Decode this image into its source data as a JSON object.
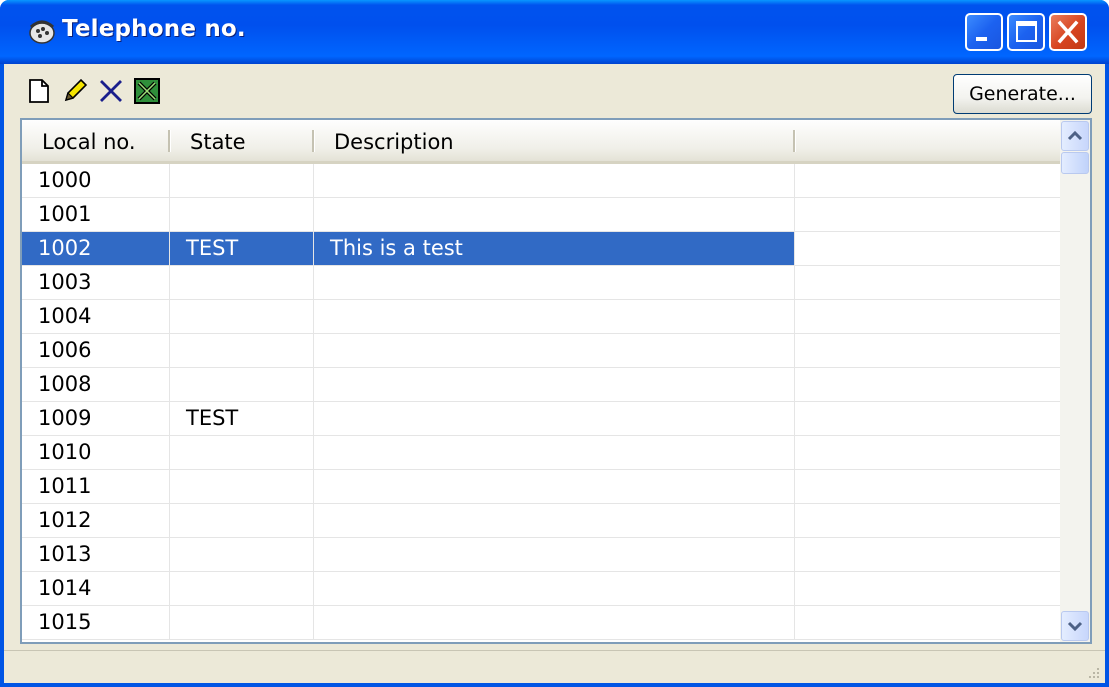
{
  "window": {
    "title": "Telephone no.",
    "icon": "phone-icon"
  },
  "toolbar": {
    "new_icon": "new-document-icon",
    "edit_icon": "pencil-icon",
    "delete_icon": "delete-x-icon",
    "excel_icon": "excel-export-icon",
    "generate_label": "Generate..."
  },
  "table": {
    "columns": [
      "Local no.",
      "State",
      "Description",
      ""
    ],
    "rows": [
      {
        "local": "1000",
        "state": "",
        "description": ""
      },
      {
        "local": "1001",
        "state": "",
        "description": ""
      },
      {
        "local": "1002",
        "state": "TEST",
        "description": "This is a test",
        "selected": true
      },
      {
        "local": "1003",
        "state": "",
        "description": ""
      },
      {
        "local": "1004",
        "state": "",
        "description": ""
      },
      {
        "local": "1006",
        "state": "",
        "description": ""
      },
      {
        "local": "1008",
        "state": "",
        "description": ""
      },
      {
        "local": "1009",
        "state": "TEST",
        "description": ""
      },
      {
        "local": "1010",
        "state": "",
        "description": ""
      },
      {
        "local": "1011",
        "state": "",
        "description": ""
      },
      {
        "local": "1012",
        "state": "",
        "description": ""
      },
      {
        "local": "1013",
        "state": "",
        "description": ""
      },
      {
        "local": "1014",
        "state": "",
        "description": ""
      },
      {
        "local": "1015",
        "state": "",
        "description": ""
      }
    ]
  },
  "colors": {
    "selection": "#316ac5",
    "titlebar": "#0053ee",
    "close_button": "#d74420"
  }
}
